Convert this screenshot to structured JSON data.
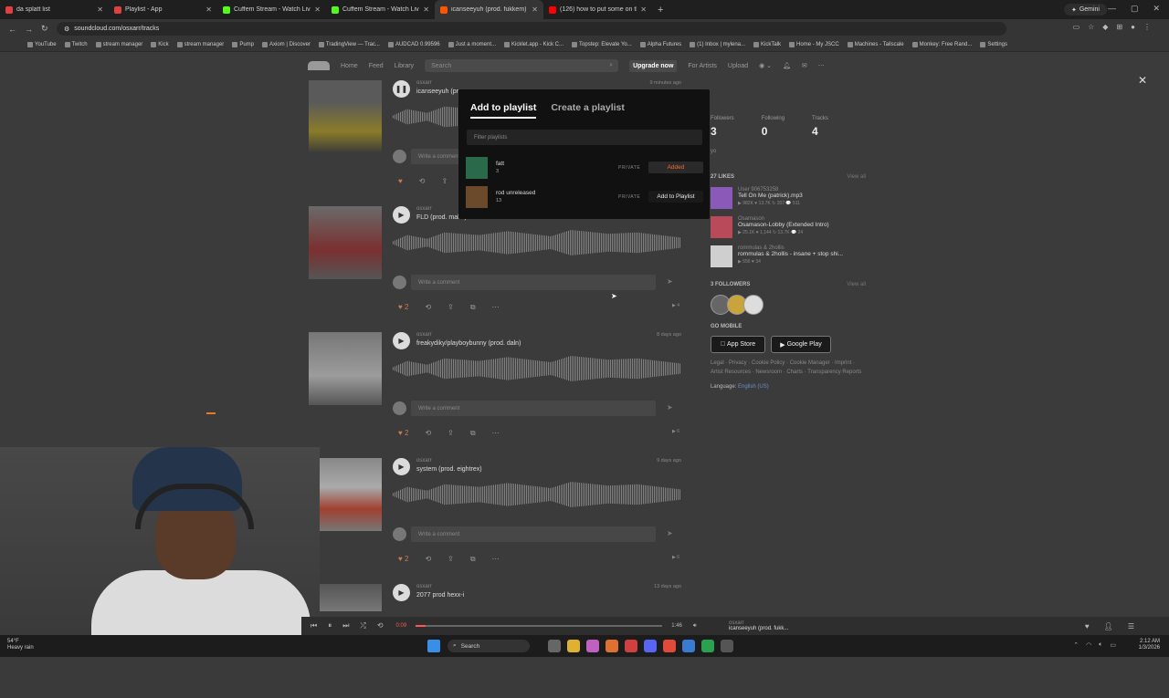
{
  "tabs": [
    {
      "label": "da splatt list",
      "color": "#e04040",
      "active": false
    },
    {
      "label": "Playlist - App",
      "color": "#e04040",
      "active": false
    },
    {
      "label": "Cuffem Stream - Watch Live on",
      "color": "#53fc18",
      "active": false
    },
    {
      "label": "Cuffem Stream - Watch Live on",
      "color": "#53fc18",
      "active": false
    },
    {
      "label": "icanseeyuh (prod. fukkem)",
      "color": "#ff5500",
      "active": true
    },
    {
      "label": "(126) how to put some on the",
      "color": "#ff0000",
      "active": false
    }
  ],
  "browser": {
    "url": "soundcloud.com/osxarr/tracks",
    "gemini": "Gemini",
    "bookmarks": [
      "YouTube",
      "Twitch",
      "stream manager",
      "Kick",
      "stream manager",
      "Pump",
      "Axiom | Discover",
      "TradingView — Trac...",
      "AUDCAD 0.99596",
      "Just a moment...",
      "Kicklet.app - Kick C...",
      "Topstep: Elevate Yo...",
      "Alpha Futures",
      "(1) Inbox | mylena...",
      "KickTalk",
      "Home - My JSCC",
      "Machines - Tailscale",
      "Monkey: Free Rand...",
      "Settings"
    ]
  },
  "nav": {
    "home": "Home",
    "feed": "Feed",
    "library": "Library",
    "search_placeholder": "Search",
    "upgrade": "Upgrade now",
    "artists": "For Artists",
    "upload": "Upload"
  },
  "tracks": [
    {
      "artist": "osxarr",
      "title": "icanseeyuh (pr",
      "date": "9 minutes ago",
      "likes": "",
      "plays": ""
    },
    {
      "artist": "osxarr",
      "title": "FLD (prod. mako)",
      "date": "",
      "likes": "2",
      "plays": "4"
    },
    {
      "artist": "osxarr",
      "title": "freakydiky/playboybunny (prod. daln)",
      "date": "8 days ago",
      "likes": "2",
      "plays": "6"
    },
    {
      "artist": "osxarr",
      "title": "system (prod. eightrex)",
      "date": "9 days ago",
      "likes": "2",
      "plays": "6"
    },
    {
      "artist": "osxarr",
      "title": "2077 prod hexx-i",
      "date": "13 days ago",
      "likes": "",
      "plays": ""
    }
  ],
  "comment_placeholder": "Write a comment",
  "modal": {
    "tab_add": "Add to playlist",
    "tab_create": "Create a playlist",
    "filter_placeholder": "Filter playlists",
    "playlists": [
      {
        "name": "fatt",
        "count": "3",
        "privacy": "PRIVATE",
        "action": "Added"
      },
      {
        "name": "rod unreleased",
        "count": "13",
        "privacy": "PRIVATE",
        "action": "Add to Playlist"
      }
    ]
  },
  "sidebar": {
    "followers_label": "Followers",
    "followers": "3",
    "following_label": "Following",
    "following": "0",
    "tracks_label": "Tracks",
    "tracks": "4",
    "bio": "yo",
    "likes_heading": "27 LIKES",
    "view_all": "View all",
    "likes": [
      {
        "artist": "User 906753258",
        "title": "Tell On Me (patrick).mp3",
        "stats": "▶ 982K  ♥ 13.7K  ↻ 207  💬 511",
        "color": "#8a5ab8"
      },
      {
        "artist": "Osamason",
        "title": "Osamason-Lobby (Extended Intro)",
        "stats": "▶ 25.1K  ♥ 1,144  ↻ 13.7K  💬 24",
        "color": "#b84a5a"
      },
      {
        "artist": "rommulas & 2hollis",
        "title": "rommulas & 2hollis - insane + stop shi...",
        "stats": "▶ 556  ♥ 34",
        "color": "#cfcfcf"
      }
    ],
    "followers_heading": "3 FOLLOWERS",
    "mobile_heading": "GO MOBILE",
    "appstore": "App Store",
    "googleplay": "Google Play",
    "legal": "Legal · Privacy · Cookie Policy · Cookie Manager · Imprint · Artist Resources · Newsroom · Charts · Transparency Reports",
    "language_label": "Language:",
    "language": "English (US)"
  },
  "player": {
    "current": "0:09",
    "total": "1:46",
    "progress": 0.04,
    "artist": "osxarr",
    "title": "icanseeyuh (prod. fukk..."
  },
  "taskbar": {
    "temp": "54°F",
    "weather": "Heavy rain",
    "search": "Search",
    "time": "2:12 AM",
    "date": "1/3/2026"
  }
}
